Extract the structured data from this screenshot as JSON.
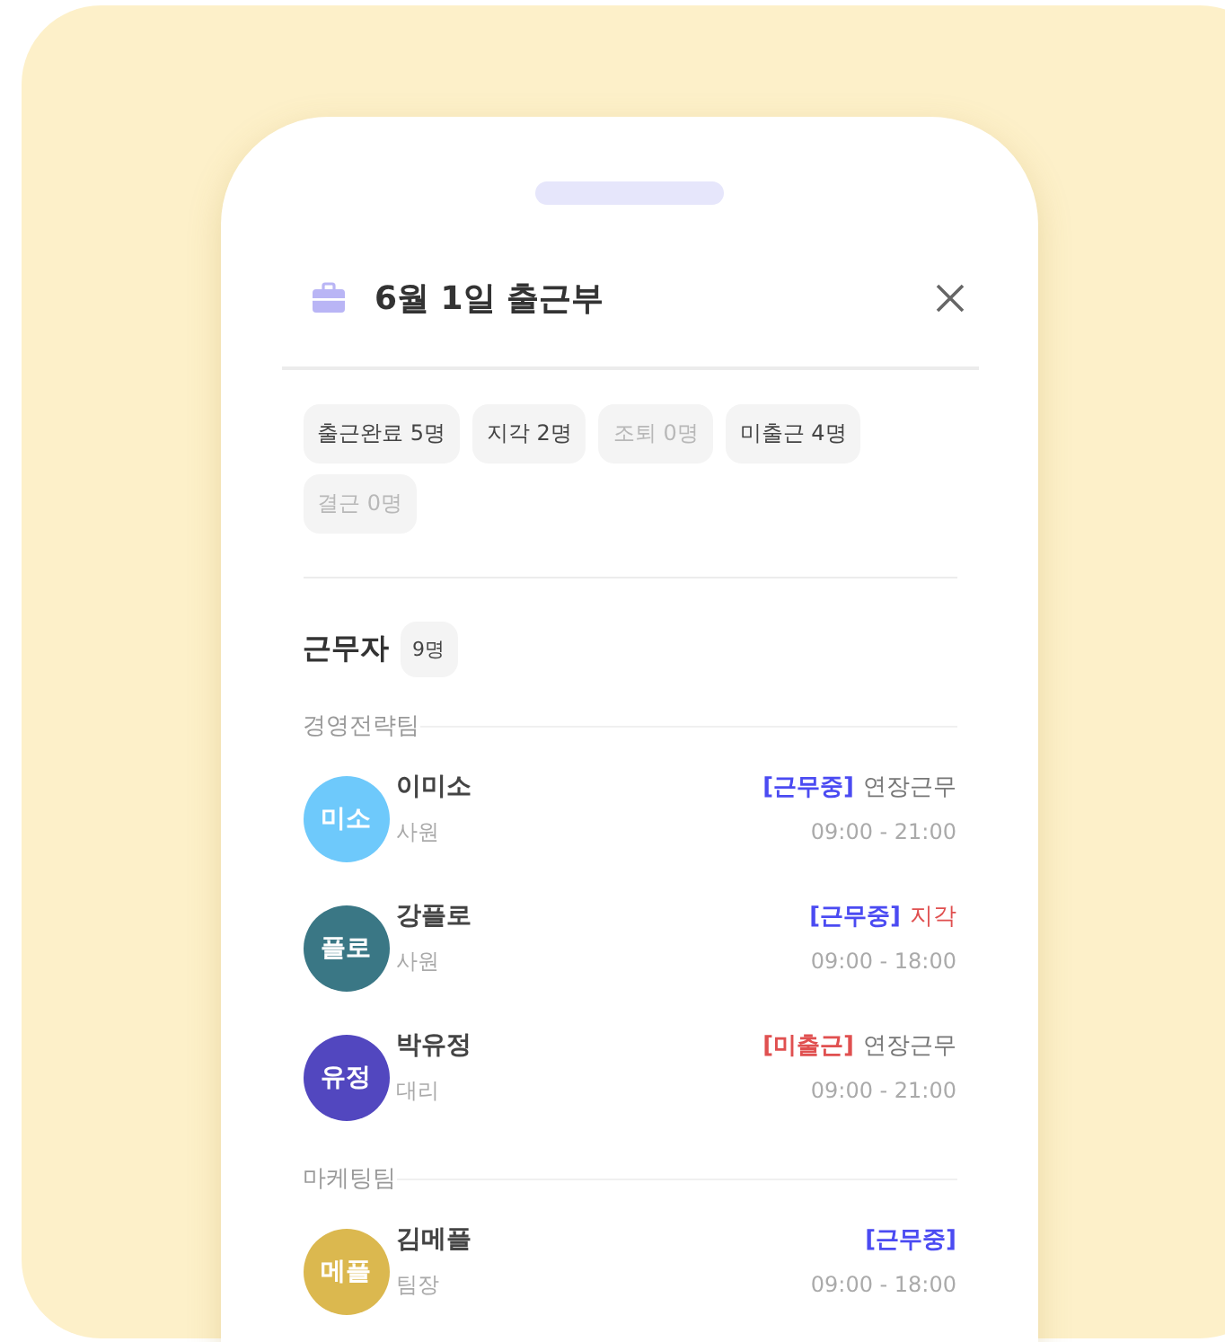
{
  "header": {
    "title": "6월 1일 출근부"
  },
  "summary_chips": [
    {
      "label": "출근완료 5명",
      "muted": false
    },
    {
      "label": "지각 2명",
      "muted": false
    },
    {
      "label": "조퇴 0명",
      "muted": true
    },
    {
      "label": "미출근 4명",
      "muted": false
    },
    {
      "label": "결근 0명",
      "muted": true
    }
  ],
  "workers": {
    "title": "근무자",
    "count": "9명",
    "teams": [
      {
        "name": "경영전략팀",
        "members": [
          {
            "avatar": "미소",
            "color": "#6ec9fb",
            "name": "이미소",
            "role": "사원",
            "status": {
              "text": "[근무중]",
              "kind": "working"
            },
            "note": {
              "text": "연장근무",
              "kind": "normal"
            },
            "hours": "09:00 - 21:00"
          },
          {
            "avatar": "플로",
            "color": "#3a7785",
            "name": "강플로",
            "role": "사원",
            "status": {
              "text": "[근무중]",
              "kind": "working"
            },
            "note": {
              "text": "지각",
              "kind": "alert"
            },
            "hours": "09:00 - 18:00"
          },
          {
            "avatar": "유정",
            "color": "#5247bf",
            "name": "박유정",
            "role": "대리",
            "status": {
              "text": "[미출근]",
              "kind": "absent"
            },
            "note": {
              "text": "연장근무",
              "kind": "normal"
            },
            "hours": "09:00 - 21:00"
          }
        ]
      },
      {
        "name": "마케팅팀",
        "members": [
          {
            "avatar": "메플",
            "color": "#dbb84f",
            "name": "김메플",
            "role": "팀장",
            "status": {
              "text": "[근무중]",
              "kind": "working"
            },
            "hours": "09:00 - 18:00"
          }
        ]
      }
    ]
  }
}
